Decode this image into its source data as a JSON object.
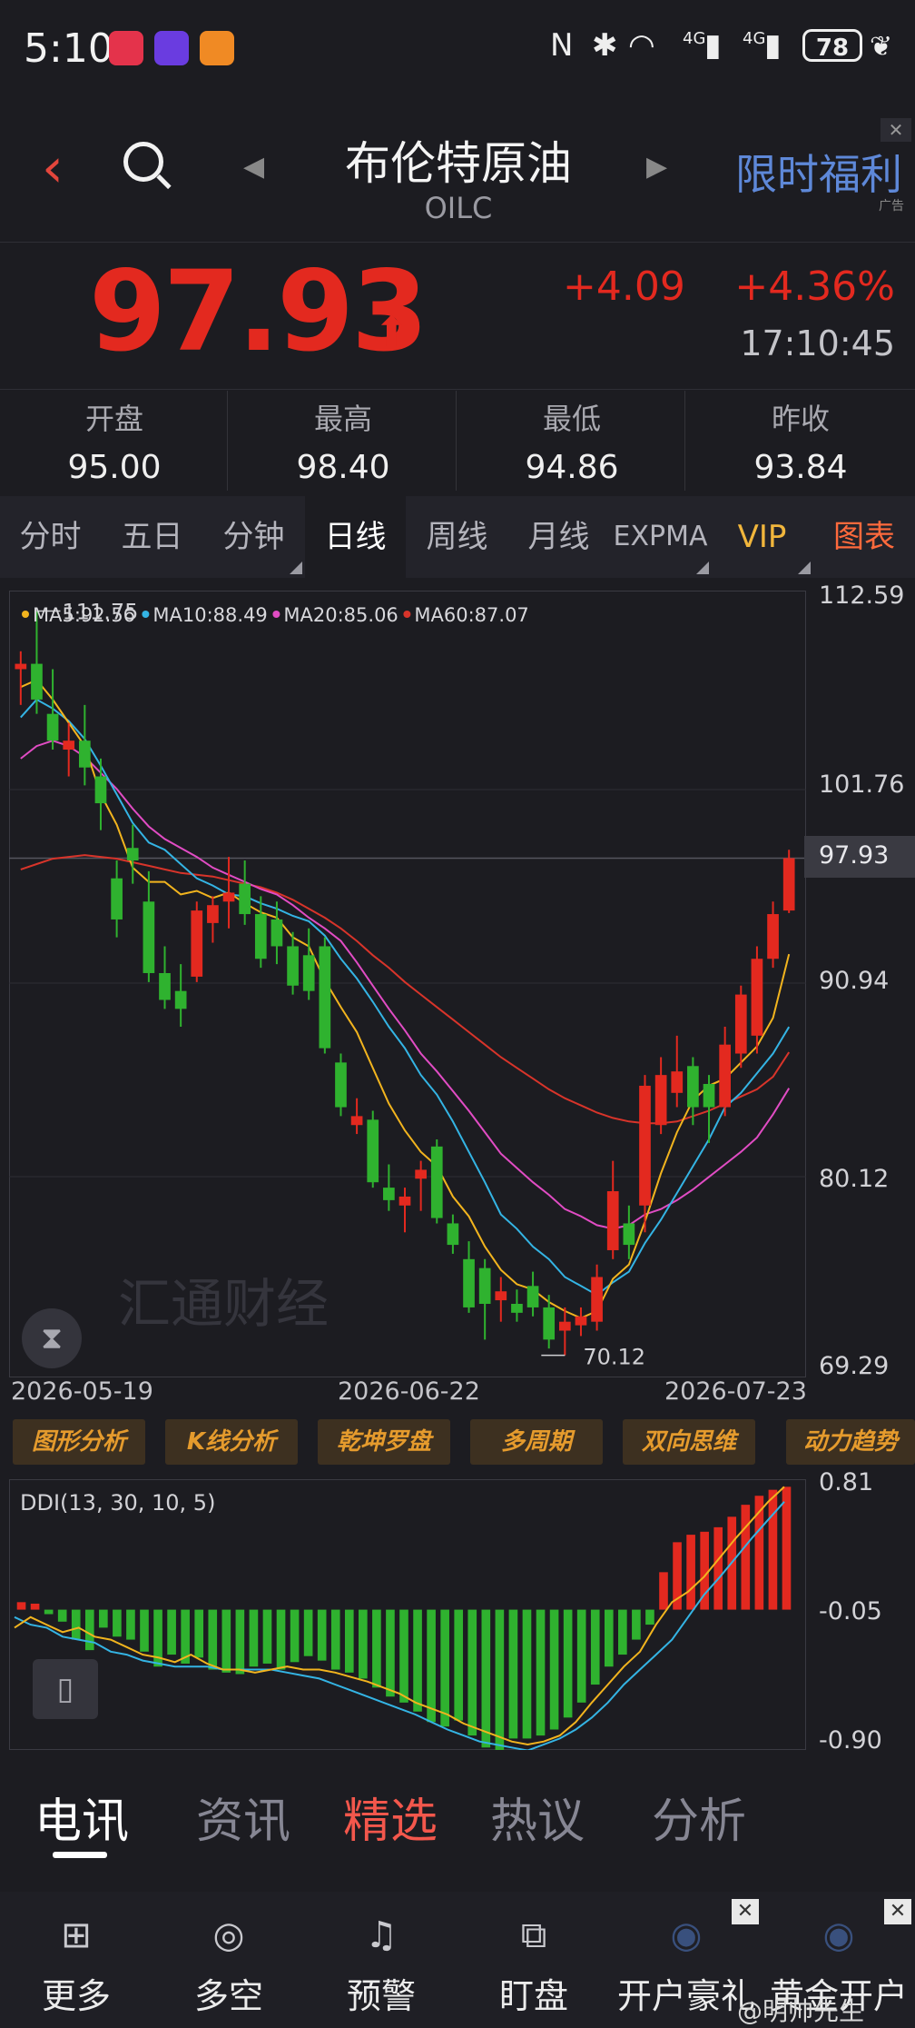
{
  "status_bar": {
    "time": "5:10",
    "signal_1": "4G",
    "signal_2": "4G",
    "battery": "78",
    "icons": [
      "huawei-app-icon",
      "link-app-icon",
      "game-app-icon",
      "nfc-icon",
      "bluetooth-icon",
      "wifi-icon",
      "signal-icon",
      "signal-icon",
      "leaf-icon"
    ]
  },
  "header": {
    "title": "布伦特原油",
    "subtitle": "OILC",
    "promo": "限时福利",
    "promo_ad": "广告"
  },
  "quote": {
    "price": "97.93",
    "change": "+4.09",
    "change_pct": "+4.36%",
    "time": "17:10:45",
    "up_color": "#e3291f"
  },
  "stats": [
    {
      "label": "开盘",
      "value": "95.00"
    },
    {
      "label": "最高",
      "value": "98.40"
    },
    {
      "label": "最低",
      "value": "94.86"
    },
    {
      "label": "昨收",
      "value": "93.84"
    }
  ],
  "tabs": [
    "分时",
    "五日",
    "分钟",
    "日线",
    "周线",
    "月线",
    "EXPMA",
    "VIP",
    "图表"
  ],
  "active_tab": "日线",
  "chart_data": [
    {
      "type": "candlestick",
      "title": "",
      "ma_legend": [
        "MA5:92.56",
        "MA10:88.49",
        "MA20:85.06",
        "MA60:87.07"
      ],
      "ma_colors": [
        "#f2b41e",
        "#34b4e4",
        "#e14cc4",
        "#d8342a"
      ],
      "y_ticks": [
        "112.59",
        "101.76",
        "90.94",
        "80.12",
        "69.29"
      ],
      "ylim": [
        69.29,
        112.59
      ],
      "last_price_tag": "97.93",
      "high_marker": "111.75",
      "low_marker": "70.12",
      "x_ticks": [
        "2026-05-19",
        "2026-06-22",
        "2026-07-23"
      ],
      "candles": [
        [
          108.5,
          109.5,
          106.5,
          108.8
        ],
        [
          108.8,
          111.75,
          106.0,
          106.8
        ],
        [
          106.0,
          108.5,
          104.0,
          104.5
        ],
        [
          104.0,
          105.5,
          102.5,
          104.5
        ],
        [
          104.5,
          106.5,
          102.0,
          103.0
        ],
        [
          102.5,
          103.5,
          99.5,
          101.0
        ],
        [
          96.8,
          97.8,
          93.5,
          94.5
        ],
        [
          98.5,
          99.8,
          96.5,
          97.8
        ],
        [
          95.5,
          97.2,
          91.0,
          91.5
        ],
        [
          91.5,
          93.0,
          89.5,
          90.0
        ],
        [
          90.5,
          92.0,
          88.5,
          89.5
        ],
        [
          91.3,
          95.5,
          91.0,
          95.0
        ],
        [
          94.3,
          95.8,
          93.2,
          95.3
        ],
        [
          95.5,
          98.0,
          94.0,
          96.0
        ],
        [
          96.5,
          97.8,
          94.2,
          94.8
        ],
        [
          94.8,
          95.8,
          91.8,
          92.3
        ],
        [
          94.5,
          95.5,
          92.0,
          93.0
        ],
        [
          93.0,
          93.8,
          90.3,
          90.8
        ],
        [
          92.5,
          94.0,
          90.0,
          90.5
        ],
        [
          93.0,
          93.5,
          87.0,
          87.3
        ],
        [
          86.5,
          87.0,
          83.5,
          84.0
        ],
        [
          83.0,
          84.5,
          82.5,
          83.5
        ],
        [
          83.3,
          83.8,
          79.5,
          79.8
        ],
        [
          79.5,
          80.8,
          78.2,
          78.8
        ],
        [
          78.5,
          79.5,
          77.0,
          79.0
        ],
        [
          80.0,
          81.0,
          78.2,
          80.5
        ],
        [
          81.8,
          82.2,
          77.5,
          77.8
        ],
        [
          77.5,
          78.0,
          75.8,
          76.3
        ],
        [
          75.5,
          76.5,
          72.5,
          72.8
        ],
        [
          75.0,
          75.5,
          71.0,
          73.0
        ],
        [
          73.2,
          74.5,
          72.0,
          73.7
        ],
        [
          73.0,
          73.8,
          72.0,
          72.5
        ],
        [
          74.0,
          74.8,
          72.3,
          72.8
        ],
        [
          72.8,
          73.5,
          70.5,
          71.0
        ],
        [
          71.5,
          72.8,
          70.12,
          72.0
        ],
        [
          71.8,
          72.8,
          71.2,
          72.3
        ],
        [
          72.0,
          75.2,
          71.5,
          74.5
        ],
        [
          76.0,
          81.0,
          75.5,
          79.3
        ],
        [
          77.5,
          78.5,
          75.5,
          76.3
        ],
        [
          78.5,
          85.8,
          77.0,
          85.2
        ],
        [
          83.0,
          86.8,
          82.5,
          85.8
        ],
        [
          84.8,
          88.0,
          84.0,
          86.0
        ],
        [
          86.3,
          86.8,
          83.0,
          84.0
        ],
        [
          85.3,
          85.8,
          82.0,
          84.0
        ],
        [
          84.0,
          88.5,
          83.5,
          87.5
        ],
        [
          87.0,
          90.8,
          86.2,
          90.3
        ],
        [
          88.0,
          93.0,
          87.0,
          92.3
        ],
        [
          92.3,
          95.5,
          91.8,
          94.8
        ],
        [
          95.0,
          98.4,
          94.86,
          97.93
        ]
      ],
      "ma5": [
        107.5,
        107.9,
        106.8,
        105.5,
        104.2,
        101.5,
        99.8,
        97.4,
        96.6,
        96.6,
        95.9,
        96.1,
        95.7,
        96.0,
        95.4,
        94.9,
        94.6,
        93.5,
        93.0,
        91.1,
        89.6,
        88.2,
        86.2,
        84.2,
        82.7,
        81.5,
        80.7,
        79.0,
        77.9,
        76.2,
        74.9,
        74.1,
        73.8,
        73.1,
        72.6,
        72.2,
        72.6,
        74.4,
        75.2,
        77.6,
        80.3,
        82.6,
        84.4,
        85.2,
        85.6,
        86.5,
        87.4,
        89.0,
        92.56
      ],
      "ma10": [
        105.8,
        106.8,
        106.3,
        105.6,
        104.6,
        103.1,
        101.5,
        99.9,
        98.8,
        98.4,
        97.6,
        96.8,
        96.4,
        95.9,
        95.8,
        95.4,
        95.1,
        94.7,
        94.4,
        93.6,
        92.3,
        91.2,
        89.9,
        88.5,
        87.3,
        85.8,
        84.7,
        83.2,
        81.5,
        79.8,
        78.0,
        77.2,
        76.2,
        75.5,
        74.5,
        74.0,
        73.5,
        74.2,
        74.8,
        76.4,
        77.7,
        79.2,
        80.7,
        82.2,
        84.0,
        84.8,
        85.9,
        87.0,
        88.49
      ],
      "ma20": [
        103.5,
        104.2,
        104.5,
        104.2,
        103.6,
        102.7,
        101.8,
        100.7,
        99.7,
        99.0,
        98.5,
        98.0,
        97.4,
        97.0,
        96.6,
        96.2,
        95.9,
        95.3,
        94.6,
        94.0,
        93.3,
        92.1,
        90.8,
        89.5,
        88.3,
        87.0,
        86.0,
        84.9,
        83.8,
        82.6,
        81.4,
        80.6,
        79.8,
        79.1,
        78.3,
        77.9,
        77.4,
        77.2,
        77.4,
        78.0,
        78.3,
        78.8,
        79.4,
        80.1,
        80.8,
        81.5,
        82.3,
        83.6,
        85.06
      ],
      "ma60": [
        97.3,
        97.6,
        97.9,
        98.0,
        98.1,
        98.0,
        97.9,
        97.7,
        97.5,
        97.3,
        97.1,
        97.0,
        96.9,
        96.7,
        96.5,
        96.3,
        96.0,
        95.6,
        95.1,
        94.6,
        94.0,
        93.3,
        92.5,
        91.8,
        91.0,
        90.3,
        89.6,
        88.9,
        88.2,
        87.5,
        86.8,
        86.2,
        85.6,
        85.0,
        84.5,
        84.1,
        83.7,
        83.4,
        83.2,
        83.1,
        83.1,
        83.2,
        83.5,
        83.8,
        84.2,
        84.6,
        85.0,
        85.7,
        87.07
      ]
    },
    {
      "type": "bar",
      "title": "DDI(13, 30, 10, 5)",
      "y_ticks": [
        "0.81",
        "-0.05",
        "-0.90"
      ],
      "ylim": [
        -0.9,
        0.81
      ],
      "values": [
        0.05,
        0.04,
        -0.03,
        -0.08,
        -0.2,
        -0.27,
        -0.12,
        -0.18,
        -0.2,
        -0.28,
        -0.38,
        -0.3,
        -0.36,
        -0.32,
        -0.4,
        -0.42,
        -0.43,
        -0.38,
        -0.36,
        -0.4,
        -0.35,
        -0.31,
        -0.34,
        -0.4,
        -0.42,
        -0.46,
        -0.52,
        -0.58,
        -0.62,
        -0.68,
        -0.75,
        -0.78,
        -0.74,
        -0.84,
        -0.92,
        -0.94,
        -0.86,
        -0.86,
        -0.84,
        -0.8,
        -0.72,
        -0.62,
        -0.5,
        -0.38,
        -0.3,
        -0.2,
        -0.1,
        0.25,
        0.45,
        0.5,
        0.52,
        0.55,
        0.62,
        0.7,
        0.76,
        0.8,
        0.82
      ],
      "line1": [
        -0.12,
        -0.05,
        -0.1,
        -0.15,
        -0.12,
        -0.18,
        -0.2,
        -0.25,
        -0.3,
        -0.32,
        -0.35,
        -0.3,
        -0.36,
        -0.4,
        -0.4,
        -0.42,
        -0.4,
        -0.38,
        -0.4,
        -0.4,
        -0.42,
        -0.45,
        -0.48,
        -0.52,
        -0.56,
        -0.62,
        -0.66,
        -0.7,
        -0.76,
        -0.8,
        -0.84,
        -0.88,
        -0.9,
        -0.88,
        -0.84,
        -0.75,
        -0.62,
        -0.5,
        -0.38,
        -0.28,
        -0.1,
        0.05,
        0.12,
        0.22,
        0.35,
        0.48,
        0.6,
        0.72,
        0.82
      ],
      "line2": [
        -0.05,
        -0.1,
        -0.12,
        -0.18,
        -0.2,
        -0.22,
        -0.28,
        -0.3,
        -0.34,
        -0.36,
        -0.38,
        -0.38,
        -0.38,
        -0.4,
        -0.4,
        -0.4,
        -0.4,
        -0.42,
        -0.44,
        -0.46,
        -0.5,
        -0.54,
        -0.58,
        -0.62,
        -0.66,
        -0.7,
        -0.75,
        -0.8,
        -0.84,
        -0.88,
        -0.9,
        -0.92,
        -0.94,
        -0.9,
        -0.86,
        -0.8,
        -0.72,
        -0.62,
        -0.5,
        -0.4,
        -0.3,
        -0.2,
        -0.05,
        0.1,
        0.22,
        0.35,
        0.48,
        0.6,
        0.72
      ]
    }
  ],
  "tools": [
    "图形分析",
    "K线分析",
    "乾坤罗盘",
    "多周期",
    "双向思维",
    "动力趋势"
  ],
  "watermark": "汇通财经",
  "news_tabs": [
    "电讯",
    "资讯",
    "精选",
    "热议",
    "分析"
  ],
  "bottom_nav": [
    {
      "label": "更多",
      "icon": "grid-icon"
    },
    {
      "label": "多空",
      "icon": "trend-icon"
    },
    {
      "label": "预警",
      "icon": "bell-icon"
    },
    {
      "label": "盯盘",
      "icon": "watch-icon"
    },
    {
      "label": "开户豪礼",
      "icon": "gift-icon"
    },
    {
      "label": "黄金开户",
      "icon": "hat-icon"
    }
  ],
  "weibo_mark": "@明帅先生"
}
